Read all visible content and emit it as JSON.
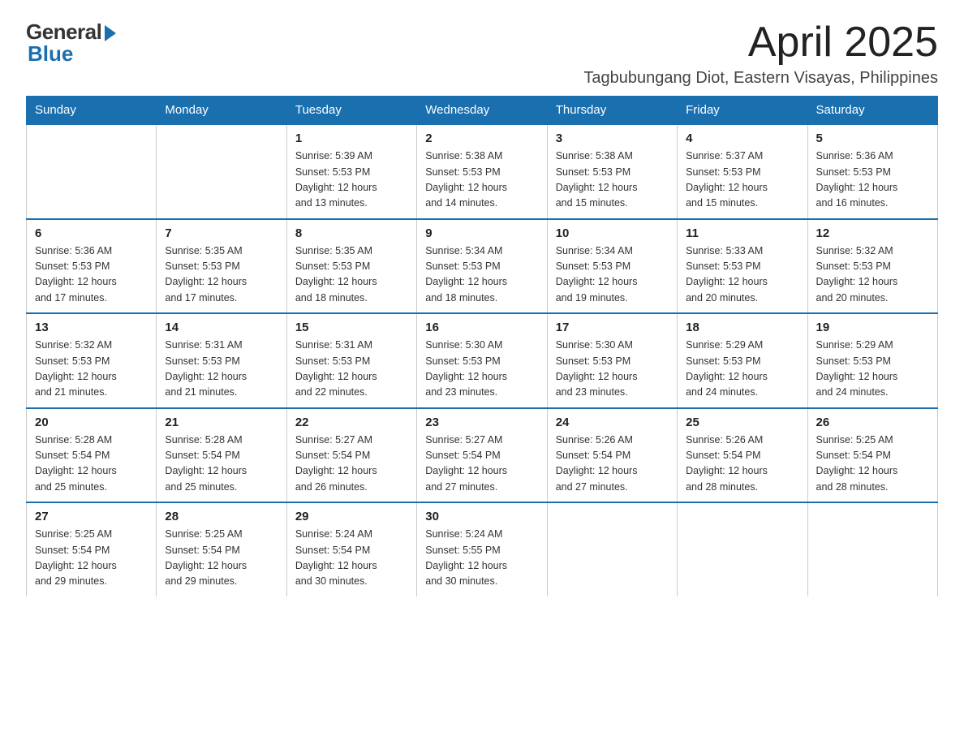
{
  "logo": {
    "general": "General",
    "blue": "Blue"
  },
  "header": {
    "month": "April 2025",
    "location": "Tagbubungang Diot, Eastern Visayas, Philippines"
  },
  "weekdays": [
    "Sunday",
    "Monday",
    "Tuesday",
    "Wednesday",
    "Thursday",
    "Friday",
    "Saturday"
  ],
  "weeks": [
    [
      {
        "day": "",
        "info": ""
      },
      {
        "day": "",
        "info": ""
      },
      {
        "day": "1",
        "info": "Sunrise: 5:39 AM\nSunset: 5:53 PM\nDaylight: 12 hours\nand 13 minutes."
      },
      {
        "day": "2",
        "info": "Sunrise: 5:38 AM\nSunset: 5:53 PM\nDaylight: 12 hours\nand 14 minutes."
      },
      {
        "day": "3",
        "info": "Sunrise: 5:38 AM\nSunset: 5:53 PM\nDaylight: 12 hours\nand 15 minutes."
      },
      {
        "day": "4",
        "info": "Sunrise: 5:37 AM\nSunset: 5:53 PM\nDaylight: 12 hours\nand 15 minutes."
      },
      {
        "day": "5",
        "info": "Sunrise: 5:36 AM\nSunset: 5:53 PM\nDaylight: 12 hours\nand 16 minutes."
      }
    ],
    [
      {
        "day": "6",
        "info": "Sunrise: 5:36 AM\nSunset: 5:53 PM\nDaylight: 12 hours\nand 17 minutes."
      },
      {
        "day": "7",
        "info": "Sunrise: 5:35 AM\nSunset: 5:53 PM\nDaylight: 12 hours\nand 17 minutes."
      },
      {
        "day": "8",
        "info": "Sunrise: 5:35 AM\nSunset: 5:53 PM\nDaylight: 12 hours\nand 18 minutes."
      },
      {
        "day": "9",
        "info": "Sunrise: 5:34 AM\nSunset: 5:53 PM\nDaylight: 12 hours\nand 18 minutes."
      },
      {
        "day": "10",
        "info": "Sunrise: 5:34 AM\nSunset: 5:53 PM\nDaylight: 12 hours\nand 19 minutes."
      },
      {
        "day": "11",
        "info": "Sunrise: 5:33 AM\nSunset: 5:53 PM\nDaylight: 12 hours\nand 20 minutes."
      },
      {
        "day": "12",
        "info": "Sunrise: 5:32 AM\nSunset: 5:53 PM\nDaylight: 12 hours\nand 20 minutes."
      }
    ],
    [
      {
        "day": "13",
        "info": "Sunrise: 5:32 AM\nSunset: 5:53 PM\nDaylight: 12 hours\nand 21 minutes."
      },
      {
        "day": "14",
        "info": "Sunrise: 5:31 AM\nSunset: 5:53 PM\nDaylight: 12 hours\nand 21 minutes."
      },
      {
        "day": "15",
        "info": "Sunrise: 5:31 AM\nSunset: 5:53 PM\nDaylight: 12 hours\nand 22 minutes."
      },
      {
        "day": "16",
        "info": "Sunrise: 5:30 AM\nSunset: 5:53 PM\nDaylight: 12 hours\nand 23 minutes."
      },
      {
        "day": "17",
        "info": "Sunrise: 5:30 AM\nSunset: 5:53 PM\nDaylight: 12 hours\nand 23 minutes."
      },
      {
        "day": "18",
        "info": "Sunrise: 5:29 AM\nSunset: 5:53 PM\nDaylight: 12 hours\nand 24 minutes."
      },
      {
        "day": "19",
        "info": "Sunrise: 5:29 AM\nSunset: 5:53 PM\nDaylight: 12 hours\nand 24 minutes."
      }
    ],
    [
      {
        "day": "20",
        "info": "Sunrise: 5:28 AM\nSunset: 5:54 PM\nDaylight: 12 hours\nand 25 minutes."
      },
      {
        "day": "21",
        "info": "Sunrise: 5:28 AM\nSunset: 5:54 PM\nDaylight: 12 hours\nand 25 minutes."
      },
      {
        "day": "22",
        "info": "Sunrise: 5:27 AM\nSunset: 5:54 PM\nDaylight: 12 hours\nand 26 minutes."
      },
      {
        "day": "23",
        "info": "Sunrise: 5:27 AM\nSunset: 5:54 PM\nDaylight: 12 hours\nand 27 minutes."
      },
      {
        "day": "24",
        "info": "Sunrise: 5:26 AM\nSunset: 5:54 PM\nDaylight: 12 hours\nand 27 minutes."
      },
      {
        "day": "25",
        "info": "Sunrise: 5:26 AM\nSunset: 5:54 PM\nDaylight: 12 hours\nand 28 minutes."
      },
      {
        "day": "26",
        "info": "Sunrise: 5:25 AM\nSunset: 5:54 PM\nDaylight: 12 hours\nand 28 minutes."
      }
    ],
    [
      {
        "day": "27",
        "info": "Sunrise: 5:25 AM\nSunset: 5:54 PM\nDaylight: 12 hours\nand 29 minutes."
      },
      {
        "day": "28",
        "info": "Sunrise: 5:25 AM\nSunset: 5:54 PM\nDaylight: 12 hours\nand 29 minutes."
      },
      {
        "day": "29",
        "info": "Sunrise: 5:24 AM\nSunset: 5:54 PM\nDaylight: 12 hours\nand 30 minutes."
      },
      {
        "day": "30",
        "info": "Sunrise: 5:24 AM\nSunset: 5:55 PM\nDaylight: 12 hours\nand 30 minutes."
      },
      {
        "day": "",
        "info": ""
      },
      {
        "day": "",
        "info": ""
      },
      {
        "day": "",
        "info": ""
      }
    ]
  ]
}
